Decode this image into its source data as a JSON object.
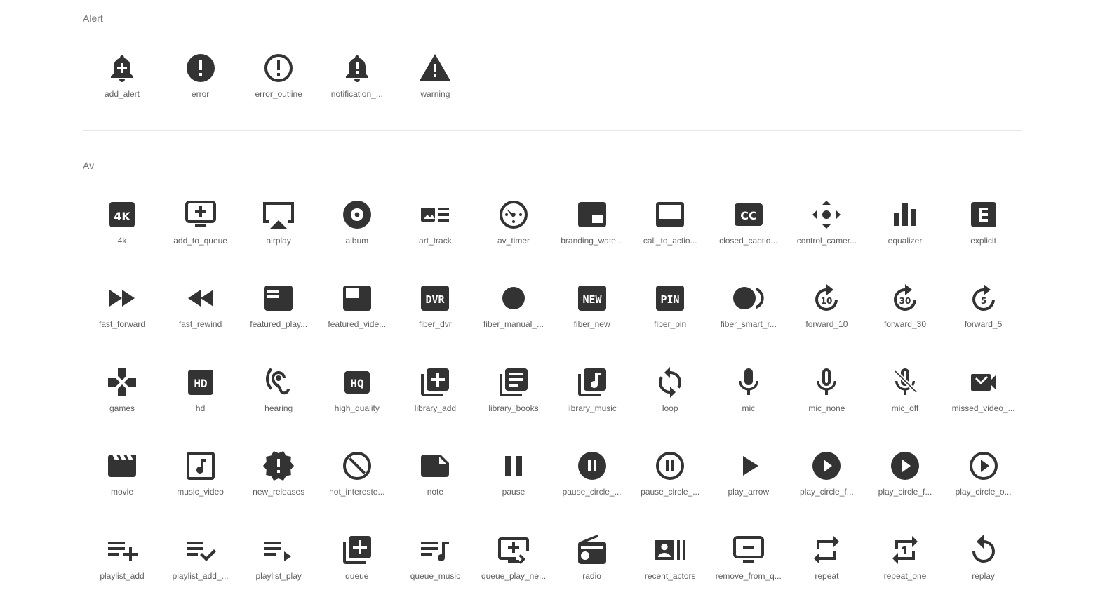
{
  "sections": [
    {
      "title": "Alert",
      "icons": [
        {
          "name": "add_alert",
          "label": "add_alert"
        },
        {
          "name": "error",
          "label": "error"
        },
        {
          "name": "error_outline",
          "label": "error_outline"
        },
        {
          "name": "notification_important",
          "label": "notification_..."
        },
        {
          "name": "warning",
          "label": "warning"
        }
      ]
    },
    {
      "title": "Av",
      "icons": [
        {
          "name": "4k",
          "label": "4k"
        },
        {
          "name": "add_to_queue",
          "label": "add_to_queue"
        },
        {
          "name": "airplay",
          "label": "airplay"
        },
        {
          "name": "album",
          "label": "album"
        },
        {
          "name": "art_track",
          "label": "art_track"
        },
        {
          "name": "av_timer",
          "label": "av_timer"
        },
        {
          "name": "branding_watermark",
          "label": "branding_wate..."
        },
        {
          "name": "call_to_action",
          "label": "call_to_actio..."
        },
        {
          "name": "closed_caption",
          "label": "closed_captio..."
        },
        {
          "name": "control_camera",
          "label": "control_camer..."
        },
        {
          "name": "equalizer",
          "label": "equalizer"
        },
        {
          "name": "explicit",
          "label": "explicit"
        },
        {
          "name": "fast_forward",
          "label": "fast_forward"
        },
        {
          "name": "fast_rewind",
          "label": "fast_rewind"
        },
        {
          "name": "featured_play_list",
          "label": "featured_play..."
        },
        {
          "name": "featured_video",
          "label": "featured_vide..."
        },
        {
          "name": "fiber_dvr",
          "label": "fiber_dvr"
        },
        {
          "name": "fiber_manual_record",
          "label": "fiber_manual_..."
        },
        {
          "name": "fiber_new",
          "label": "fiber_new"
        },
        {
          "name": "fiber_pin",
          "label": "fiber_pin"
        },
        {
          "name": "fiber_smart_record",
          "label": "fiber_smart_r..."
        },
        {
          "name": "forward_10",
          "label": "forward_10"
        },
        {
          "name": "forward_30",
          "label": "forward_30"
        },
        {
          "name": "forward_5",
          "label": "forward_5"
        },
        {
          "name": "games",
          "label": "games"
        },
        {
          "name": "hd",
          "label": "hd"
        },
        {
          "name": "hearing",
          "label": "hearing"
        },
        {
          "name": "high_quality",
          "label": "high_quality"
        },
        {
          "name": "library_add",
          "label": "library_add"
        },
        {
          "name": "library_books",
          "label": "library_books"
        },
        {
          "name": "library_music",
          "label": "library_music"
        },
        {
          "name": "loop",
          "label": "loop"
        },
        {
          "name": "mic",
          "label": "mic"
        },
        {
          "name": "mic_none",
          "label": "mic_none"
        },
        {
          "name": "mic_off",
          "label": "mic_off"
        },
        {
          "name": "missed_video_call",
          "label": "missed_video_..."
        },
        {
          "name": "movie",
          "label": "movie"
        },
        {
          "name": "music_video",
          "label": "music_video"
        },
        {
          "name": "new_releases",
          "label": "new_releases"
        },
        {
          "name": "not_interested",
          "label": "not_intereste..."
        },
        {
          "name": "note",
          "label": "note"
        },
        {
          "name": "pause",
          "label": "pause"
        },
        {
          "name": "pause_circle_filled",
          "label": "pause_circle_..."
        },
        {
          "name": "pause_circle_outline",
          "label": "pause_circle_..."
        },
        {
          "name": "play_arrow",
          "label": "play_arrow"
        },
        {
          "name": "play_circle_filled",
          "label": "play_circle_f..."
        },
        {
          "name": "play_circle_filled_white",
          "label": "play_circle_f..."
        },
        {
          "name": "play_circle_outline",
          "label": "play_circle_o..."
        },
        {
          "name": "playlist_add",
          "label": "playlist_add"
        },
        {
          "name": "playlist_add_check",
          "label": "playlist_add_..."
        },
        {
          "name": "playlist_play",
          "label": "playlist_play"
        },
        {
          "name": "queue",
          "label": "queue"
        },
        {
          "name": "queue_music",
          "label": "queue_music"
        },
        {
          "name": "queue_play_next",
          "label": "queue_play_ne..."
        },
        {
          "name": "radio",
          "label": "radio"
        },
        {
          "name": "recent_actors",
          "label": "recent_actors"
        },
        {
          "name": "remove_from_queue",
          "label": "remove_from_q..."
        },
        {
          "name": "repeat",
          "label": "repeat"
        },
        {
          "name": "repeat_one",
          "label": "repeat_one"
        },
        {
          "name": "replay",
          "label": "replay"
        }
      ]
    }
  ],
  "colors": {
    "icon": "#333333",
    "label": "#616161",
    "section_title": "#757575",
    "divider": "#e6e6e6"
  }
}
